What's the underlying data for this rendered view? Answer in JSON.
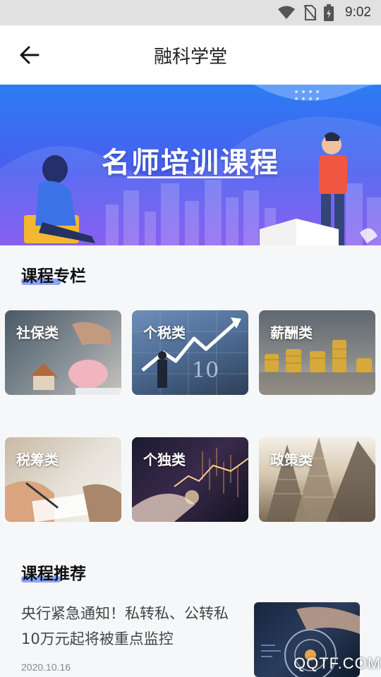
{
  "status_bar": {
    "time": "9:02",
    "icons": [
      "wifi-icon",
      "no-sim-icon",
      "battery-icon"
    ]
  },
  "app_bar": {
    "title": "融科学堂",
    "back_icon": "arrow-left-icon"
  },
  "banner": {
    "headline": "名师培训课程"
  },
  "sections": {
    "columns_title": "课程专栏",
    "recommend_title": "课程推荐"
  },
  "categories": [
    {
      "label": "社保类"
    },
    {
      "label": "个税类"
    },
    {
      "label": "薪酬类"
    },
    {
      "label": "税筹类"
    },
    {
      "label": "个独类"
    },
    {
      "label": "政策类"
    }
  ],
  "recommendations": [
    {
      "title": "央行紧急通知！私转私、公转私10万元起将被重点监控",
      "date": "2020.10.16"
    }
  ],
  "watermark": "QQTF.COM",
  "colors": {
    "accent": "#4f79ff",
    "banner_top": "#2c7cf2",
    "banner_bottom": "#7c4ef0"
  }
}
